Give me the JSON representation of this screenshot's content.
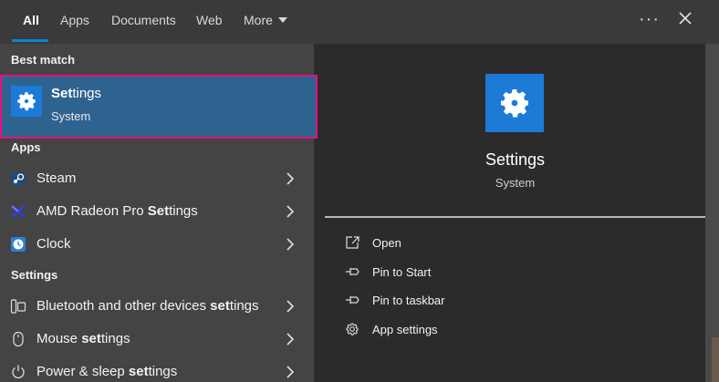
{
  "tabs": [
    {
      "label": "All",
      "active": true
    },
    {
      "label": "Apps"
    },
    {
      "label": "Documents"
    },
    {
      "label": "Web"
    },
    {
      "label": "More"
    }
  ],
  "header": {
    "more_options_icon": "ellipsis-icon",
    "close_icon": "close-icon"
  },
  "left": {
    "best_match_label": "Best match",
    "best_match": {
      "title_bold": "Set",
      "title_rest": "tings",
      "subtitle": "System",
      "icon": "gear-icon"
    },
    "apps_label": "Apps",
    "apps": [
      {
        "pre": "Steam",
        "bold": "",
        "post": "",
        "icon": "steam-icon"
      },
      {
        "pre": "AMD Radeon Pro ",
        "bold": "Set",
        "post": "tings",
        "icon": "amd-radeon-icon"
      },
      {
        "pre": "Clock",
        "bold": "",
        "post": "",
        "icon": "clock-icon"
      }
    ],
    "settings_label": "Settings",
    "settings": [
      {
        "pre": "Bluetooth and other devices ",
        "bold": "set",
        "post": "tings",
        "icon": "devices-icon"
      },
      {
        "pre": "Mouse ",
        "bold": "set",
        "post": "tings",
        "icon": "mouse-icon"
      },
      {
        "pre": "Power & sleep ",
        "bold": "set",
        "post": "tings",
        "icon": "power-icon"
      }
    ]
  },
  "detail": {
    "title": "Settings",
    "subtitle": "System",
    "actions": [
      {
        "label": "Open",
        "icon": "open-icon"
      },
      {
        "label": "Pin to Start",
        "icon": "pin-icon"
      },
      {
        "label": "Pin to taskbar",
        "icon": "pin-icon"
      },
      {
        "label": "App settings",
        "icon": "gear-icon"
      }
    ]
  },
  "colors": {
    "accent": "#1d7ad6",
    "highlight_border": "#e4127a",
    "selection": "#2e6390"
  }
}
